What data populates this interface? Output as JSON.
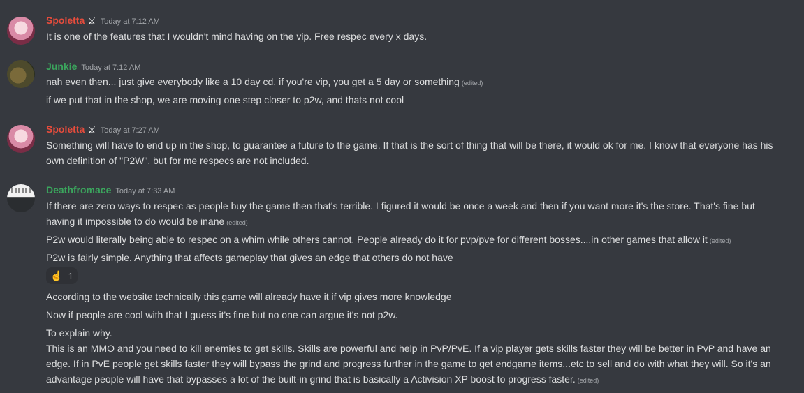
{
  "colors": {
    "background": "#36393f",
    "spoletta": "#e74c3c",
    "junkie": "#3ba55d",
    "deathfromace": "#3ba55d",
    "text": "#dcddde",
    "muted": "#a3a6aa"
  },
  "messages": [
    {
      "username": "Spoletta",
      "badge_icon": "crossed-swords-icon",
      "timestamp": "Today at 7:12 AM",
      "lines": [
        {
          "text": "It is one of the features that I wouldn't mind having on the vip. Free respec every x days."
        }
      ]
    },
    {
      "username": "Junkie",
      "timestamp": "Today at 7:12 AM",
      "lines": [
        {
          "text": "nah even then... just give everybody like a 10 day cd. if you're vip, you get a 5 day or something",
          "edited": "(edited)"
        },
        {
          "text": "if we put that in the shop, we are moving one step closer to p2w, and thats not cool"
        }
      ]
    },
    {
      "username": "Spoletta",
      "badge_icon": "crossed-swords-icon",
      "timestamp": "Today at 7:27 AM",
      "lines": [
        {
          "text": "Something will have to end up in the shop, to guarantee a future to the game. If that is the sort of thing that will be there, it would ok for me. I know that everyone has his own definition of \"P2W\", but for me respecs are not included."
        }
      ]
    },
    {
      "username": "Deathfromace",
      "timestamp": "Today at 7:33 AM",
      "lines": [
        {
          "text": "If there are zero ways to respec as people buy the game then that's terrible. I figured it would be once a week and then if you want more it's the store. That's fine but having it impossible to do would be inane",
          "edited": "(edited)"
        },
        {
          "text": "P2w would literally being able to respec on a whim while others cannot. People already do it for pvp/pve for different bosses....in other games that allow it",
          "edited": "(edited)"
        },
        {
          "text": "P2w is fairly simple. Anything that affects gameplay that gives an edge that others do not have"
        },
        {
          "text": "According to the website technically this game will already have it if vip gives more knowledge"
        },
        {
          "text": "Now if people are cool with that I guess it's fine but no one can argue it's not p2w."
        },
        {
          "text": "To explain why."
        },
        {
          "text": "This is an MMO and you need to kill enemies to get skills. Skills are powerful and help in PvP/PvE. If a vip player gets skills faster they will be better in PvP and have an edge. If in PvE people get skills faster they will bypass the grind and progress further in the game to get endgame items...etc to sell and do with what they will. So it's an advantage people will have that bypasses a lot of the built-in grind that is basically a Activision XP boost to progress faster.",
          "edited": "(edited)"
        }
      ],
      "reaction": {
        "emoji": "☝️",
        "count": "1"
      }
    }
  ]
}
